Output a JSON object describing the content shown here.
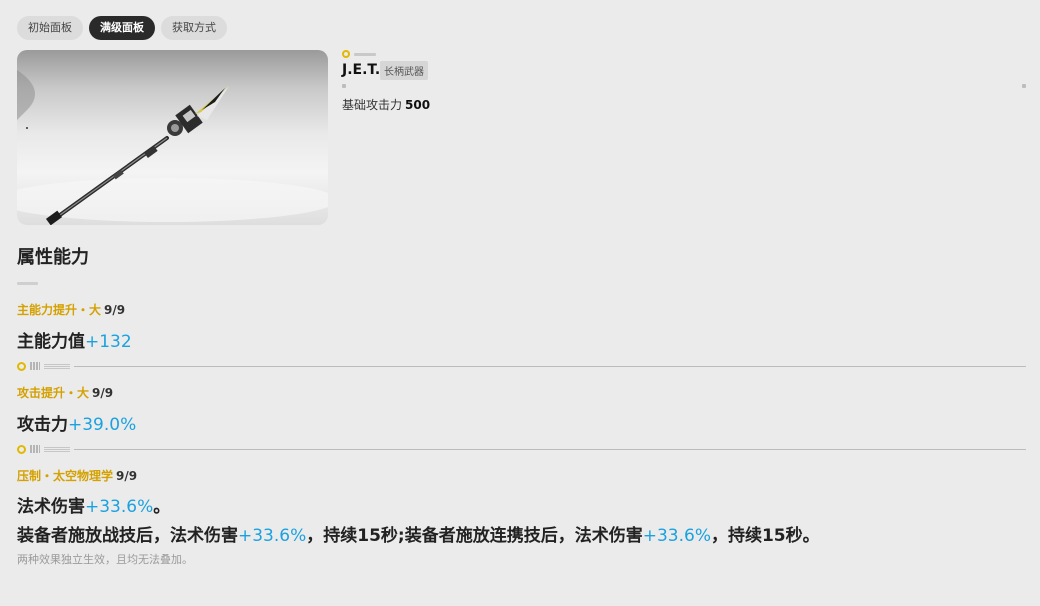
{
  "tabs": [
    {
      "label": "初始面板",
      "active": false
    },
    {
      "label": "满级面板",
      "active": true
    },
    {
      "label": "获取方式",
      "active": false
    }
  ],
  "weapon": {
    "name": "J.E.T.",
    "type": "长柄武器",
    "base_attack_label": "基础攻击力",
    "base_attack_value": "500",
    "image_icon": "spear-icon"
  },
  "section": {
    "title": "属性能力"
  },
  "attributes": [
    {
      "label": "主能力提升・大",
      "level": "9/9",
      "value_text": "主能力值",
      "value_highlight": "+132"
    },
    {
      "label": "攻击提升・大",
      "level": "9/9",
      "value_text": "攻击力",
      "value_highlight": "+39.0%"
    },
    {
      "label": "压制・太空物理学",
      "level": "9/9",
      "line1_text": "法术伤害",
      "line1_highlight": "+33.6%",
      "line1_tail": "。",
      "line2_a": "装备者施放战技后，法术伤害",
      "line2_hl1": "+33.6%",
      "line2_b": "，持续15秒;装备者施放连携技后，法术伤害",
      "line2_hl2": "+33.6%",
      "line2_c": "，持续15秒。",
      "note": "两种效果独立生效，且均无法叠加。"
    }
  ],
  "colors": {
    "accent_gold": "#d4a100",
    "highlight_blue": "#1aa2e0",
    "active_tab": "#2a2a2a"
  }
}
